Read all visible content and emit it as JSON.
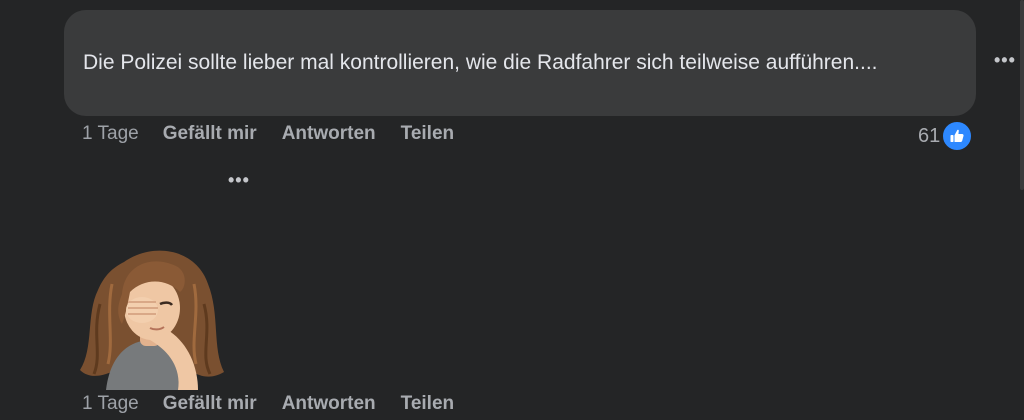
{
  "comment1": {
    "text": "Die Polizei sollte lieber mal kontrollieren, wie die Radfahrer sich teilweise aufführen....",
    "time": "1 Tage",
    "like_label": "Gefällt mir",
    "reply_label": "Antworten",
    "share_label": "Teilen",
    "reaction_count": "61",
    "reaction_icon": "thumbs-up-icon",
    "more_icon": "more-options-icon"
  },
  "comment2": {
    "sticker": "facepalm-avatar-sticker",
    "more_icon": "more-options-icon",
    "time": "1 Tage",
    "like_label": "Gefällt mir",
    "reply_label": "Antworten",
    "share_label": "Teilen"
  },
  "colors": {
    "background": "#242526",
    "bubble": "#3a3b3c",
    "text": "#e4e6eb",
    "secondary_text": "#a8abb0",
    "like_blue": "#2d88ff"
  }
}
